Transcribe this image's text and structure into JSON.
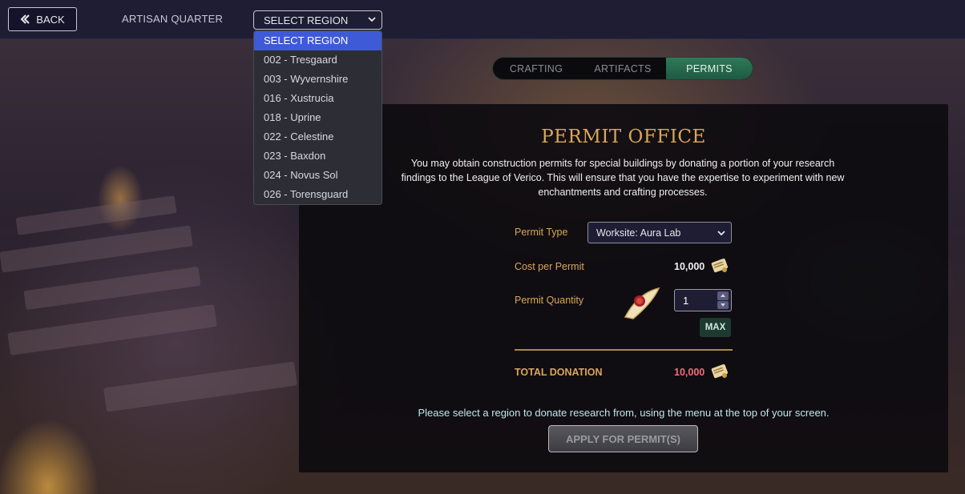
{
  "topbar": {
    "back_label": "BACK",
    "area_title": "ARTISAN QUARTER",
    "region_select": {
      "value": "SELECT REGION",
      "options": [
        "SELECT REGION",
        "002 - Tresgaard",
        "003 - Wyvernshire",
        "016 - Xustrucia",
        "018 - Uprine",
        "022 - Celestine",
        "023 - Baxdon",
        "024 - Novus Sol",
        "026 - Torensguard"
      ]
    }
  },
  "tabs": [
    {
      "label": "CRAFTING",
      "active": false
    },
    {
      "label": "ARTIFACTS",
      "active": false
    },
    {
      "label": "PERMITS",
      "active": true
    }
  ],
  "panel": {
    "title": "PERMIT OFFICE",
    "intro_line1": "You may obtain construction permits for special buildings by donating a portion of your research",
    "intro_line2": "findings to the League of Verico. This will ensure that you have the expertise to experiment with new",
    "intro_line3": "enchantments and crafting processes.",
    "permit_type_label": "Permit Type",
    "permit_type_value": "Worksite: Aura Lab",
    "cost_label": "Cost per Permit",
    "cost_value": "10,000",
    "quantity_label": "Permit Quantity",
    "quantity_value": "1",
    "max_label": "MAX",
    "total_label": "TOTAL DONATION",
    "total_value": "10,000",
    "notice": "Please select a region to donate research from, using the menu at the top of your screen.",
    "apply_label": "APPLY FOR PERMIT(S)"
  },
  "colors": {
    "accent_gold": "#d9a65a",
    "active_tab": "#2f7a5a",
    "selected_option": "#3f5ad6",
    "total_red": "#f26d7a"
  },
  "icons": [
    "back-arrow-icon",
    "chevron-down-icon",
    "research-scroll-icon",
    "permit-scroll-icon"
  ]
}
